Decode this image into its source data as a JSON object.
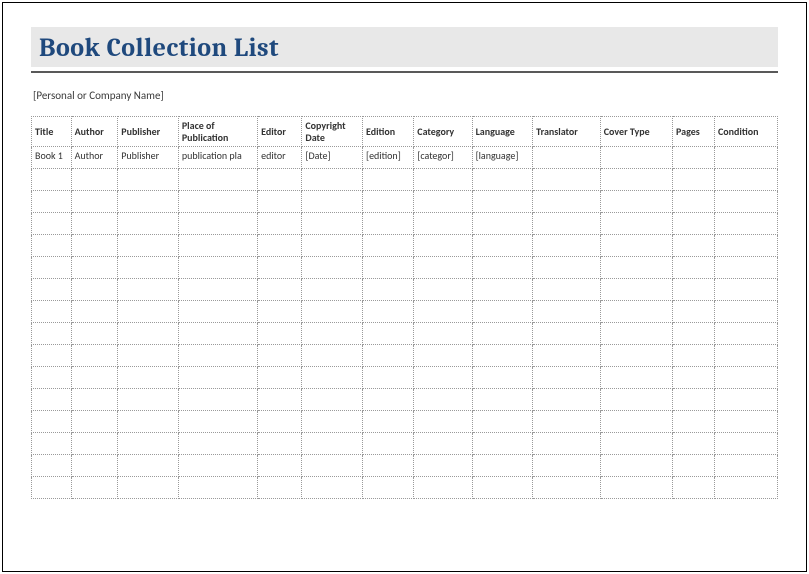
{
  "header": {
    "title": "Book Collection List",
    "subtitle": "[Personal or Company Name]"
  },
  "table": {
    "columns": [
      "Title",
      "Author",
      "Publisher",
      "Place of Publication",
      "Editor",
      "Copyright Date",
      "Edition",
      "Category",
      "Language",
      "Translator",
      "Cover Type",
      "Pages",
      "Condition"
    ],
    "rows": [
      [
        "Book 1",
        "Author",
        "Publisher",
        "publication pla",
        "editor",
        "[Date]",
        "[edition]",
        "[categor]",
        "[language]",
        "",
        "",
        "",
        ""
      ],
      [
        "",
        "",
        "",
        "",
        "",
        "",
        "",
        "",
        "",
        "",
        "",
        "",
        ""
      ],
      [
        "",
        "",
        "",
        "",
        "",
        "",
        "",
        "",
        "",
        "",
        "",
        "",
        ""
      ],
      [
        "",
        "",
        "",
        "",
        "",
        "",
        "",
        "",
        "",
        "",
        "",
        "",
        ""
      ],
      [
        "",
        "",
        "",
        "",
        "",
        "",
        "",
        "",
        "",
        "",
        "",
        "",
        ""
      ],
      [
        "",
        "",
        "",
        "",
        "",
        "",
        "",
        "",
        "",
        "",
        "",
        "",
        ""
      ],
      [
        "",
        "",
        "",
        "",
        "",
        "",
        "",
        "",
        "",
        "",
        "",
        "",
        ""
      ],
      [
        "",
        "",
        "",
        "",
        "",
        "",
        "",
        "",
        "",
        "",
        "",
        "",
        ""
      ],
      [
        "",
        "",
        "",
        "",
        "",
        "",
        "",
        "",
        "",
        "",
        "",
        "",
        ""
      ],
      [
        "",
        "",
        "",
        "",
        "",
        "",
        "",
        "",
        "",
        "",
        "",
        "",
        ""
      ],
      [
        "",
        "",
        "",
        "",
        "",
        "",
        "",
        "",
        "",
        "",
        "",
        "",
        ""
      ],
      [
        "",
        "",
        "",
        "",
        "",
        "",
        "",
        "",
        "",
        "",
        "",
        "",
        ""
      ],
      [
        "",
        "",
        "",
        "",
        "",
        "",
        "",
        "",
        "",
        "",
        "",
        "",
        ""
      ],
      [
        "",
        "",
        "",
        "",
        "",
        "",
        "",
        "",
        "",
        "",
        "",
        "",
        ""
      ],
      [
        "",
        "",
        "",
        "",
        "",
        "",
        "",
        "",
        "",
        "",
        "",
        "",
        ""
      ],
      [
        "",
        "",
        "",
        "",
        "",
        "",
        "",
        "",
        "",
        "",
        "",
        "",
        ""
      ]
    ]
  }
}
